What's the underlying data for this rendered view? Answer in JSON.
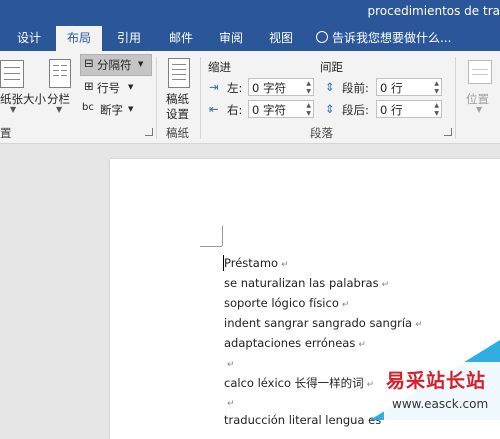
{
  "window": {
    "doc_title": "procedimientos de tra"
  },
  "tabs": [
    {
      "label": "设计"
    },
    {
      "label": "布局",
      "active": true
    },
    {
      "label": "引用"
    },
    {
      "label": "邮件"
    },
    {
      "label": "审阅"
    },
    {
      "label": "视图"
    }
  ],
  "tell_me": "告诉我您想要做什么...",
  "ribbon": {
    "page_setup": {
      "size_label": "纸张大小",
      "columns_label": "分栏",
      "breaks_label": "分隔符",
      "line_numbers_label": "行号",
      "hyphenation_label": "断字",
      "group_label": "置"
    },
    "manuscript": {
      "button_line1": "稿纸",
      "button_line2": "设置",
      "group_label": "稿纸"
    },
    "paragraph": {
      "indent_header": "缩进",
      "spacing_header": "间距",
      "left_label": "左:",
      "right_label": "右:",
      "before_label": "段前:",
      "after_label": "段后:",
      "left_value": "0 字符",
      "right_value": "0 字符",
      "before_value": "0 行",
      "after_value": "0 行",
      "group_label": "段落"
    },
    "arrange": {
      "position_label": "位置"
    }
  },
  "document": {
    "lines": [
      "Préstamo",
      "se naturalizan las palabras",
      "soporte lógico físico",
      "indent sangrar sangrado sangría",
      "adaptaciones erróneas",
      "",
      "calco léxico  长得一样的词",
      "",
      "traducción literal lengua es"
    ],
    "paragraph_mark": "↵"
  },
  "watermark": {
    "text": "易采站长站",
    "url": "www.easck.com"
  }
}
